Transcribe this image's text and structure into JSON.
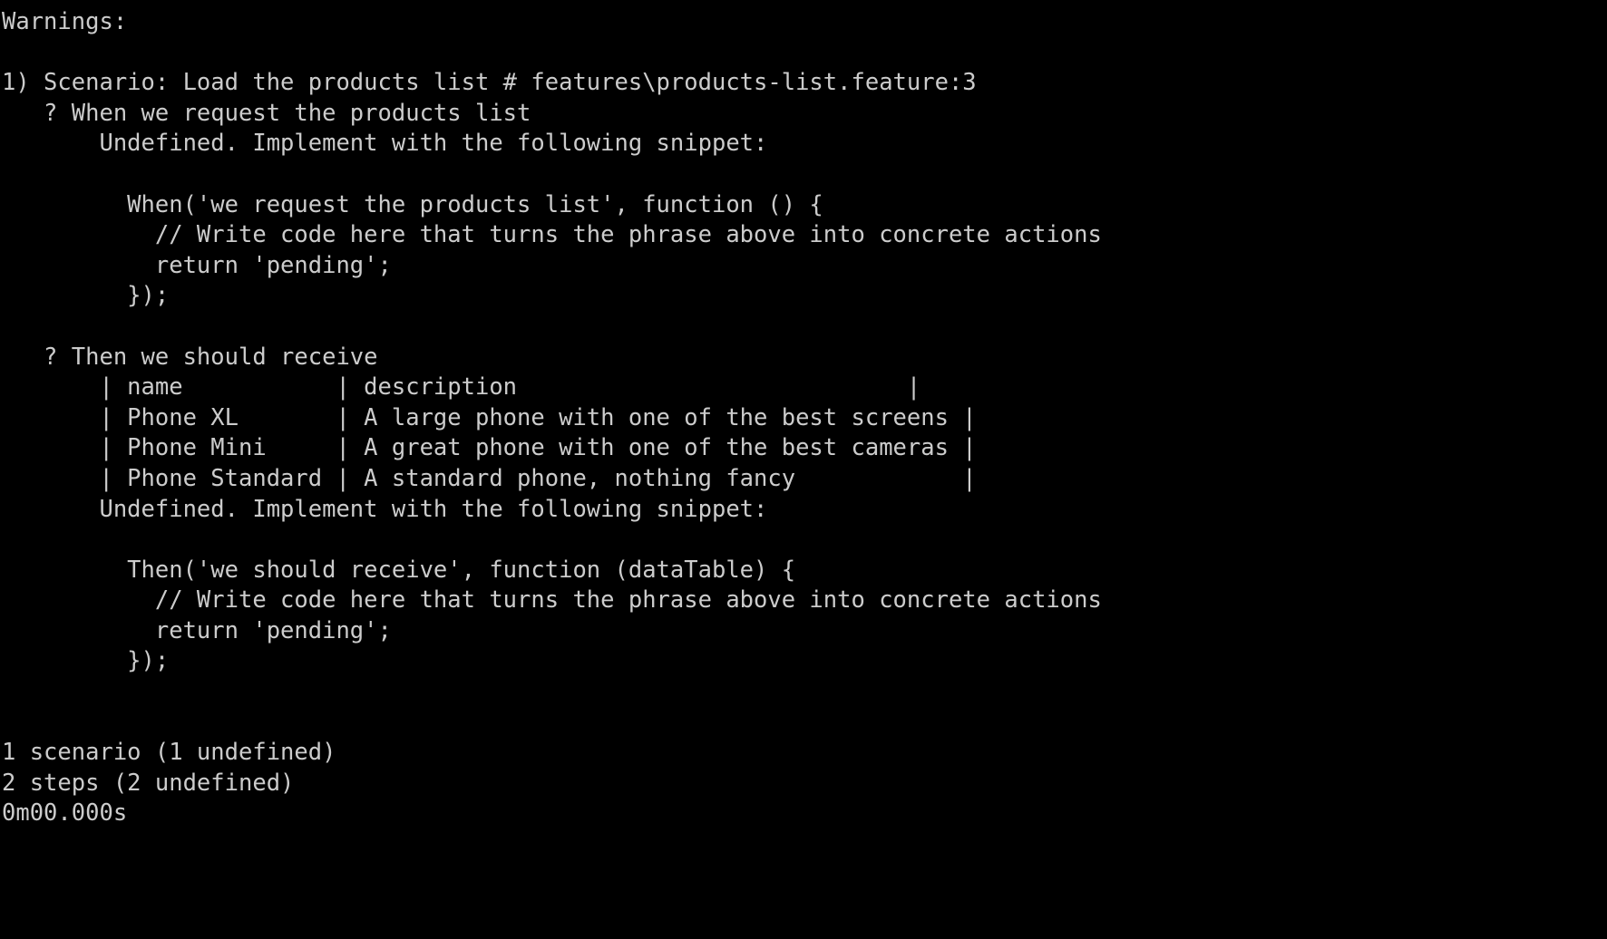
{
  "terminal": {
    "background_color": "#000000",
    "foreground_color": "#cccccc",
    "program": "cucumber-js",
    "lines": [
      {
        "id": "warnings-header",
        "text": "Warnings:"
      },
      {
        "id": "blank-1",
        "text": ""
      },
      {
        "id": "scenario-header",
        "text": "1) Scenario: Load the products list # features\\products-list.feature:3"
      },
      {
        "id": "step-when",
        "text": "   ? When we request the products list"
      },
      {
        "id": "undefined-notice-1",
        "text": "       Undefined. Implement with the following snippet:"
      },
      {
        "id": "blank-2",
        "text": ""
      },
      {
        "id": "snippet-1-open",
        "text": "         When('we request the products list', function () {"
      },
      {
        "id": "snippet-1-comment",
        "text": "           // Write code here that turns the phrase above into concrete actions"
      },
      {
        "id": "snippet-1-return",
        "text": "           return 'pending';"
      },
      {
        "id": "snippet-1-close",
        "text": "         });"
      },
      {
        "id": "blank-3",
        "text": ""
      },
      {
        "id": "step-then",
        "text": "   ? Then we should receive"
      },
      {
        "id": "table-header",
        "text": "       | name           | description                            |"
      },
      {
        "id": "table-row-1",
        "text": "       | Phone XL       | A large phone with one of the best screens |"
      },
      {
        "id": "table-row-2",
        "text": "       | Phone Mini     | A great phone with one of the best cameras |"
      },
      {
        "id": "table-row-3",
        "text": "       | Phone Standard | A standard phone, nothing fancy            |"
      },
      {
        "id": "undefined-notice-2",
        "text": "       Undefined. Implement with the following snippet:"
      },
      {
        "id": "blank-4",
        "text": ""
      },
      {
        "id": "snippet-2-open",
        "text": "         Then('we should receive', function (dataTable) {"
      },
      {
        "id": "snippet-2-comment",
        "text": "           // Write code here that turns the phrase above into concrete actions"
      },
      {
        "id": "snippet-2-return",
        "text": "           return 'pending';"
      },
      {
        "id": "snippet-2-close",
        "text": "         });"
      },
      {
        "id": "blank-5",
        "text": ""
      },
      {
        "id": "blank-6",
        "text": ""
      },
      {
        "id": "summary-scenarios",
        "text": "1 scenario (1 undefined)"
      },
      {
        "id": "summary-steps",
        "text": "2 steps (2 undefined)"
      },
      {
        "id": "summary-duration",
        "text": "0m00.000s"
      }
    ],
    "data_table": {
      "columns": [
        "name",
        "description"
      ],
      "rows": [
        [
          "Phone XL",
          "A large phone with one of the best screens"
        ],
        [
          "Phone Mini",
          "A great phone with one of the best cameras"
        ],
        [
          "Phone Standard",
          "A standard phone, nothing fancy"
        ]
      ]
    },
    "summary": {
      "scenarios": "1 scenario (1 undefined)",
      "steps": "2 steps (2 undefined)",
      "duration": "0m00.000s"
    },
    "feature_reference": "features\\products-list.feature:3",
    "scenario_name": "Load the products list",
    "steps": [
      {
        "keyword": "When",
        "text": "we request the products list",
        "status": "undefined"
      },
      {
        "keyword": "Then",
        "text": "we should receive",
        "status": "undefined"
      }
    ]
  }
}
